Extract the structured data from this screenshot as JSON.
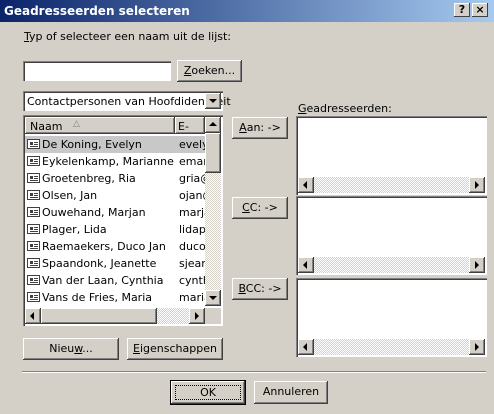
{
  "window": {
    "title": "Geadresseerden selecteren",
    "help_label": "?",
    "close_label": "×"
  },
  "search": {
    "label_prefix": "T",
    "label_rest": "yp of selecteer een naam uit de lijst:",
    "value": "",
    "find_button_prefix": "Z",
    "find_button_rest": "oeken..."
  },
  "addressbook": {
    "selected": "Contactpersonen van Hoofdidentiteit"
  },
  "contacts": {
    "columns": {
      "name": "Naam",
      "email": "E-ma"
    },
    "rows": [
      {
        "name": "De Koning, Evelyn",
        "email": "evely"
      },
      {
        "name": "Eykelenkamp, Marianne",
        "email": "emar"
      },
      {
        "name": "Groetenbreg, Ria",
        "email": "gria@"
      },
      {
        "name": "Olsen, Jan",
        "email": "ojan@"
      },
      {
        "name": "Ouwehand, Marjan",
        "email": "marja"
      },
      {
        "name": "Plager, Lida",
        "email": "lidap"
      },
      {
        "name": "Raemaekers, Duco Jan",
        "email": "duco"
      },
      {
        "name": "Spaandonk, Jeanette",
        "email": "sjean"
      },
      {
        "name": "Van der Laan, Cynthia",
        "email": "cynth"
      },
      {
        "name": "Vans de Fries, Maria",
        "email": "maria"
      }
    ]
  },
  "buttons": {
    "to_prefix": "A",
    "to_rest": "an: ->",
    "cc_prefix": "C",
    "cc_rest": "C: ->",
    "bcc_prefix": "B",
    "bcc_rest": "CC: ->",
    "new_a": "Nieu",
    "new_u": "w",
    "new_b": "...",
    "props_prefix": "E",
    "props_rest": "igenschappen",
    "ok": "OK",
    "cancel": "Annuleren"
  },
  "recipients": {
    "label_prefix": "G",
    "label_rest": "eadresseerden:"
  }
}
